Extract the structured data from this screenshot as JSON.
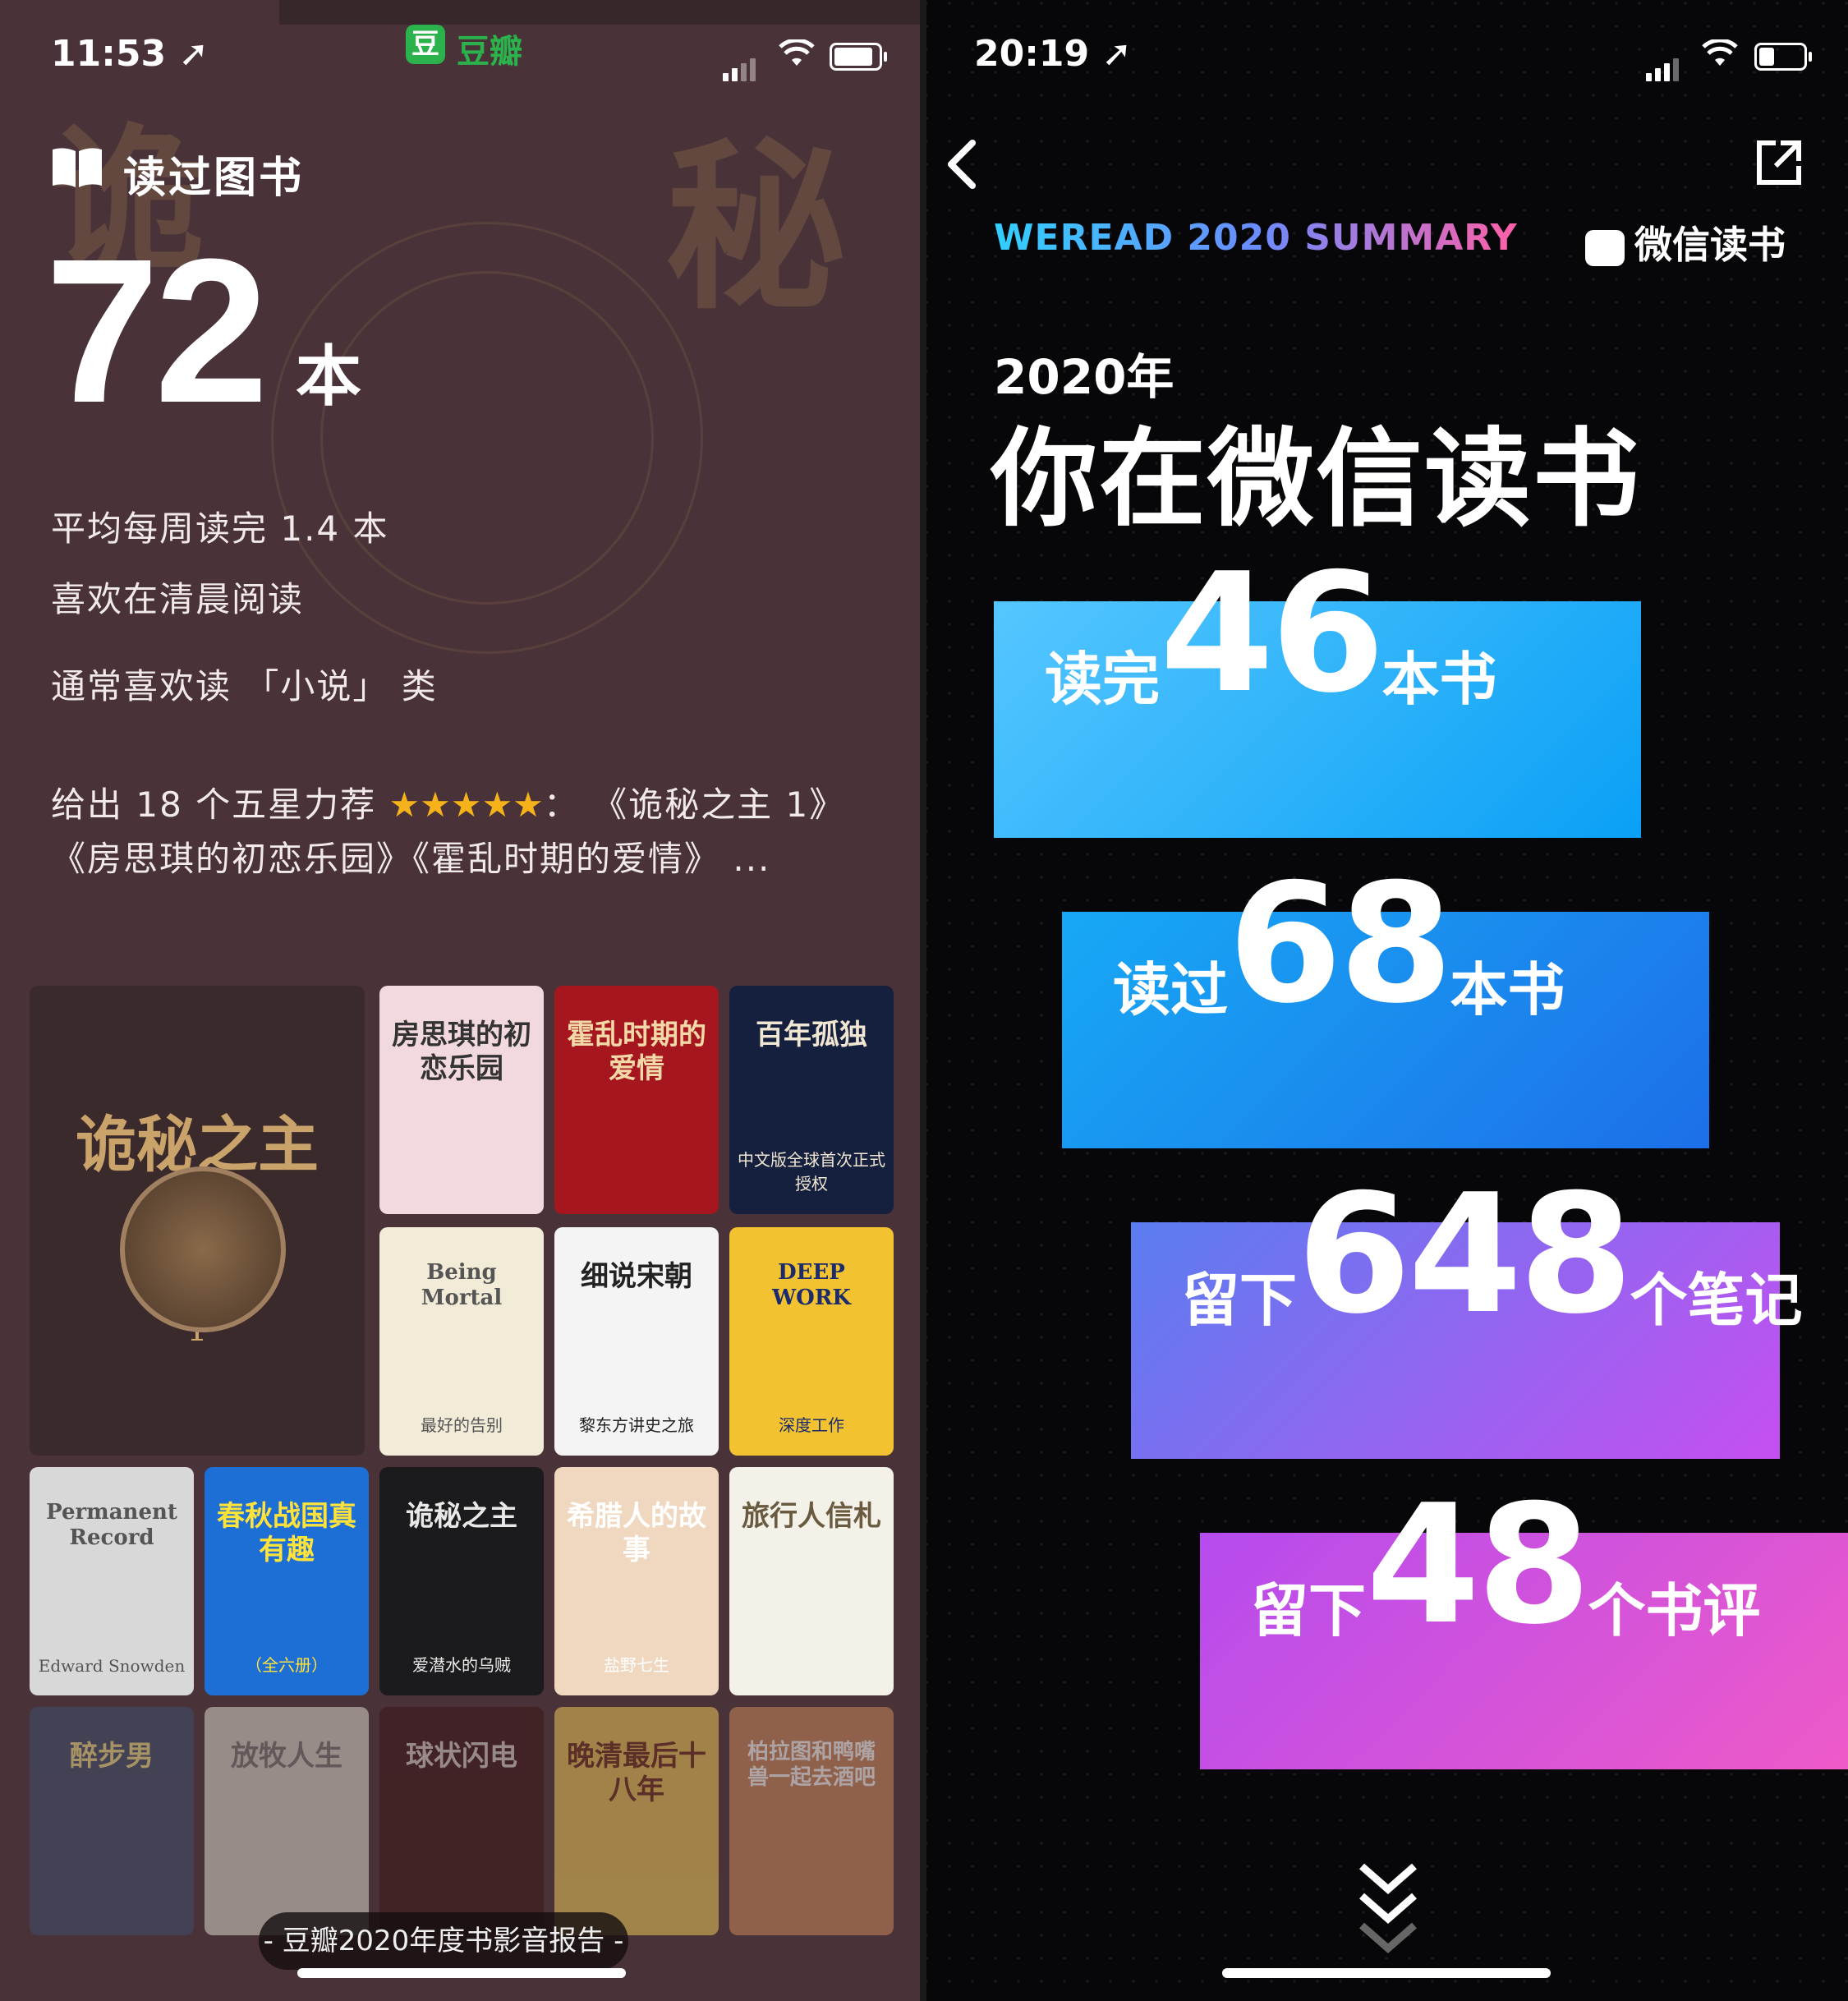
{
  "left": {
    "status": {
      "time": "11:53 ➚"
    },
    "app_name": "豆瓣",
    "section_title": "读过图书",
    "count": "72",
    "count_unit": "本",
    "stats": [
      "平均每周读完 1.4 本",
      "喜欢在清晨阅读",
      "通常喜欢读 「小说」 类"
    ],
    "recommend_prefix": "给出 18 个五星力荐 ",
    "recommend_stars": "★★★★★",
    "recommend_suffix": "： 《诡秘之主 1》",
    "recommend_line2": "《房思琪的初恋乐园》《霍乱时期的爱情》 ...",
    "covers": [
      {
        "text": "诡秘之主",
        "sub": "1",
        "color": "#3a2a2c",
        "fg": "#c9a36a"
      },
      {
        "text": "房思琪的初恋乐园",
        "color": "#f2d9de",
        "fg": "#333"
      },
      {
        "text": "霍乱时期的爱情",
        "color": "#a5161f",
        "fg": "#f4d9a8"
      },
      {
        "text": "百年孤独",
        "sub": "中文版全球首次正式授权",
        "color": "#15203f",
        "fg": "#f0e6d2"
      },
      {
        "text": "Being Mortal",
        "sub": "最好的告别",
        "color": "#f1ebd8",
        "fg": "#555"
      },
      {
        "text": "细说宋朝",
        "sub": "黎东方讲史之旅",
        "color": "#f4f4f4",
        "fg": "#222"
      },
      {
        "text": "DEEP WORK",
        "sub": "深度工作",
        "color": "#f2c230",
        "fg": "#1b2b6b"
      },
      {
        "text": "Permanent Record",
        "sub": "Edward Snowden",
        "color": "#d8d8d8",
        "fg": "#555"
      },
      {
        "text": "春秋战国真有趣",
        "sub": "（全六册）",
        "color": "#1d6fd6",
        "fg": "#ffe23a"
      },
      {
        "text": "诡秘之主",
        "sub": "爱潜水的乌贼",
        "color": "#1b1b1d",
        "fg": "#e8e8e8"
      },
      {
        "text": "希腊人的故事",
        "sub": "盐野七生",
        "color": "#f0d8c0",
        "fg": "#fff"
      },
      {
        "text": "旅行人信札",
        "color": "#f4f1e8",
        "fg": "#6a5a40"
      },
      {
        "text": "醉步男",
        "color": "#3f4d6b",
        "fg": "#f0e08a"
      },
      {
        "text": "放牧人生",
        "color": "#d9d6cc",
        "fg": "#777"
      },
      {
        "text": "球状闪电",
        "color": "#3a1518",
        "fg": "#d8d0d0"
      },
      {
        "text": "晚清最后十八年",
        "color": "#e9c65a",
        "fg": "#6a2a1a"
      },
      {
        "text": "柏拉图和鸭嘴兽一起去酒吧",
        "color": "#c8865a",
        "fg": "#fff"
      }
    ],
    "report_label": "- 豆瓣2020年度书影音报告 -"
  },
  "right": {
    "status": {
      "time": "20:19 ➚"
    },
    "summary_label": "WEREAD 2020 SUMMARY",
    "brand": "微信读书",
    "year": "2020年",
    "headline": "你在微信读书",
    "cards": [
      {
        "pre": "读完",
        "num": "46",
        "post": "本书",
        "from": "#55c6ff",
        "to": "#0aa0f5"
      },
      {
        "pre": "读过",
        "num": "68",
        "post": "本书",
        "from": "#17a9f5",
        "to": "#1d6fe8"
      },
      {
        "pre": "留下",
        "num": "648",
        "post": "个笔记",
        "from": "#5a7df0",
        "to": "#c64ff0"
      },
      {
        "pre": "留下",
        "num": "48",
        "post": "个书评",
        "from": "#b64bee",
        "to": "#ee5ac8"
      }
    ]
  }
}
